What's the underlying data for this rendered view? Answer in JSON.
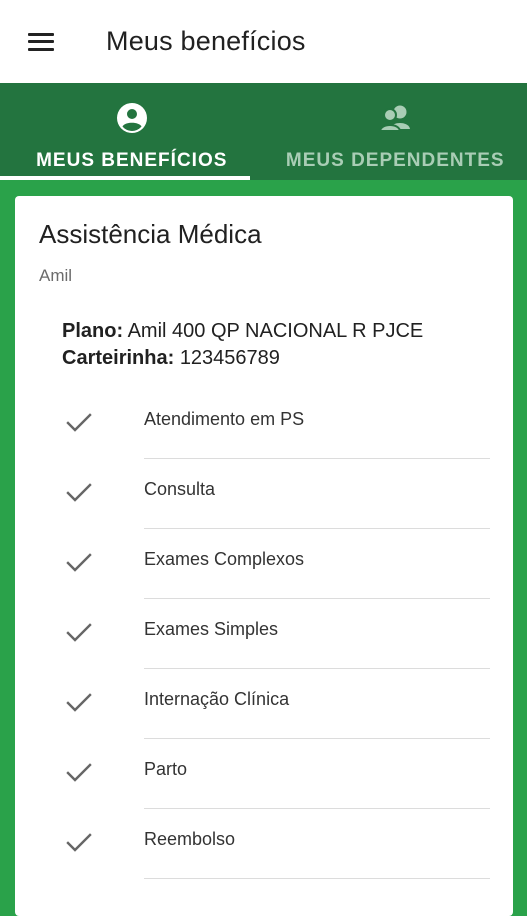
{
  "appbar": {
    "title": "Meus benefícios",
    "menu_icon": "hamburger-menu-icon"
  },
  "tabs": [
    {
      "label": "MEUS BENEFÍCIOS",
      "icon": "person-circle-icon",
      "active": true
    },
    {
      "label": "MEUS DEPENDENTES",
      "icon": "people-icon",
      "active": false
    }
  ],
  "colors": {
    "background": "#2aa24a",
    "tab_bar": "#23743f",
    "tab_inactive_text": "#a9cdb5",
    "card": "#ffffff"
  },
  "card": {
    "title": "Assistência Médica",
    "provider": "Amil",
    "plan_label": "Plano:",
    "plan_value": "Amil 400 QP NACIONAL R PJCE",
    "card_label": "Carteirinha:",
    "card_value": "123456789",
    "benefits": [
      {
        "label": "Atendimento em PS",
        "icon": "check-icon"
      },
      {
        "label": "Consulta",
        "icon": "check-icon"
      },
      {
        "label": "Exames Complexos",
        "icon": "check-icon"
      },
      {
        "label": "Exames Simples",
        "icon": "check-icon"
      },
      {
        "label": "Internação Clínica",
        "icon": "check-icon"
      },
      {
        "label": "Parto",
        "icon": "check-icon"
      },
      {
        "label": "Reembolso",
        "icon": "check-icon"
      }
    ]
  }
}
